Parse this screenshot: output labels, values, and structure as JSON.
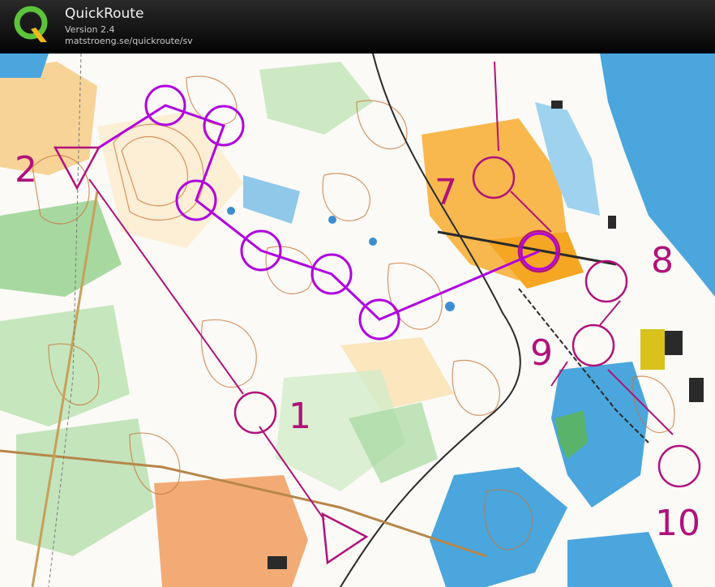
{
  "app": {
    "title": "QuickRoute",
    "version": "Version 2.4",
    "url": "matstroeng.se/quickroute/sv"
  },
  "colors": {
    "route": "#b000e0",
    "course": "#b0127a",
    "water": "#55b7e3",
    "open_land": "#f5a623",
    "forest": "#ffffff",
    "green": "#86c98a"
  },
  "course": {
    "control_labels": [
      "2",
      "7",
      "8",
      "9",
      "1",
      "10"
    ]
  },
  "icons": [
    "quickroute-logo-icon"
  ]
}
